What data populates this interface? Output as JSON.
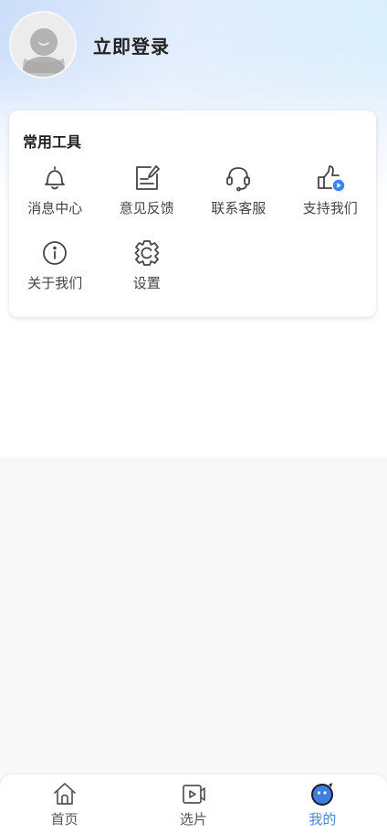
{
  "profile": {
    "login_text": "立即登录"
  },
  "tools": {
    "title": "常用工具",
    "items": [
      {
        "label": "消息中心",
        "icon": "bell-icon"
      },
      {
        "label": "意见反馈",
        "icon": "feedback-icon"
      },
      {
        "label": "联系客服",
        "icon": "headset-icon"
      },
      {
        "label": "支持我们",
        "icon": "thumbs-up-icon"
      },
      {
        "label": "关于我们",
        "icon": "info-icon"
      },
      {
        "label": "设置",
        "icon": "settings-icon"
      }
    ]
  },
  "tabbar": {
    "items": [
      {
        "label": "首页",
        "icon": "home-icon",
        "active": false
      },
      {
        "label": "选片",
        "icon": "video-icon",
        "active": false
      },
      {
        "label": "我的",
        "icon": "mascot-icon",
        "active": true
      }
    ]
  },
  "colors": {
    "accent": "#4a86d8",
    "text": "#333333",
    "badge": "#3b82f6"
  }
}
